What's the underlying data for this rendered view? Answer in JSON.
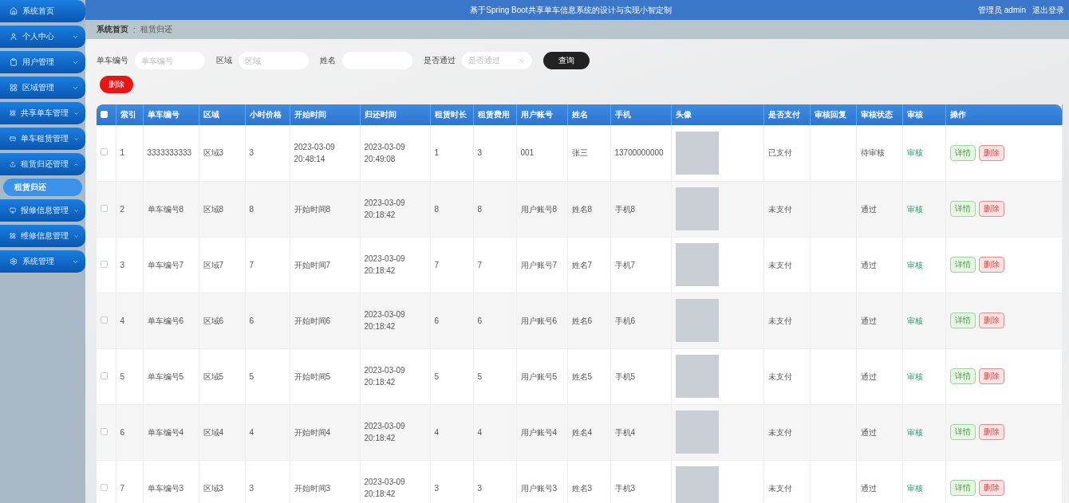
{
  "header": {
    "title": "基于Spring Boot共享单车信息系统的设计与实现小智定制",
    "user": "管理员 admin",
    "logout": "退出登录"
  },
  "sidebar": {
    "items": [
      {
        "label": "系统首页"
      },
      {
        "label": "个人中心",
        "expanded": false
      },
      {
        "label": "用户管理",
        "expanded": false
      },
      {
        "label": "区域管理",
        "expanded": false
      },
      {
        "label": "共享单车管理",
        "expanded": false
      },
      {
        "label": "单车租赁管理",
        "expanded": false
      },
      {
        "label": "租赁归还管理",
        "expanded": true,
        "children": [
          {
            "label": "租赁归还",
            "selected": true
          }
        ]
      },
      {
        "label": "报修信息管理",
        "expanded": false
      },
      {
        "label": "维修信息管理",
        "expanded": false
      },
      {
        "label": "系统管理",
        "expanded": false
      }
    ]
  },
  "breadcrumb": {
    "items": [
      "系统首页",
      "租赁归还"
    ],
    "separator": ":"
  },
  "search": {
    "fields": [
      {
        "label": "单车编号",
        "kind": "input",
        "placeholder": "单车编号"
      },
      {
        "label": "区域",
        "kind": "input",
        "placeholder": "区域"
      },
      {
        "label": "姓名",
        "kind": "input"
      },
      {
        "label": "是否通过",
        "kind": "select",
        "placeholder": "是否通过"
      }
    ],
    "button": "查询"
  },
  "delete_button": "删除",
  "table": {
    "select_all_checked": false,
    "columns": [
      "索引",
      "单车编号",
      "区域",
      "小时价格",
      "开始时间",
      "归还时间",
      "租赁时长",
      "租赁费用",
      "用户账号",
      "姓名",
      "手机",
      "头像",
      "是否支付",
      "审核回复",
      "审核状态",
      "审核",
      "操作"
    ],
    "rows": [
      {
        "cells": [
          "1",
          "3333333333",
          "区域3",
          "3",
          "2023-03-09 20:48:14",
          "2023-03-09 20:49:08",
          "1",
          "3",
          "001",
          "张三",
          "13700000000"
        ],
        "paid": "已支付",
        "status": "待审核",
        "review": "审核",
        "checked": false,
        "actions": [
          "详情",
          "删除"
        ]
      },
      {
        "cells": [
          "2",
          "单车编号8",
          "区域8",
          "8",
          "开始时间8",
          "2023-03-09 20:18:42",
          "8",
          "8",
          "用户账号8",
          "姓名8",
          "手机8"
        ],
        "paid": "未支付",
        "status": "通过",
        "review": "审核",
        "checked": false,
        "actions": [
          "详情",
          "删除"
        ]
      },
      {
        "cells": [
          "3",
          "单车编号7",
          "区域7",
          "7",
          "开始时间7",
          "2023-03-09 20:18:42",
          "7",
          "7",
          "用户账号7",
          "姓名7",
          "手机7"
        ],
        "paid": "未支付",
        "status": "通过",
        "review": "审核",
        "checked": false,
        "actions": [
          "详情",
          "删除"
        ]
      },
      {
        "cells": [
          "4",
          "单车编号6",
          "区域6",
          "6",
          "开始时间6",
          "2023-03-09 20:18:42",
          "6",
          "6",
          "用户账号6",
          "姓名6",
          "手机6"
        ],
        "paid": "未支付",
        "status": "通过",
        "review": "审核",
        "checked": false,
        "actions": [
          "详情",
          "删除"
        ]
      },
      {
        "cells": [
          "5",
          "单车编号5",
          "区域5",
          "5",
          "开始时间5",
          "2023-03-09 20:18:42",
          "5",
          "5",
          "用户账号5",
          "姓名5",
          "手机5"
        ],
        "paid": "未支付",
        "status": "通过",
        "review": "审核",
        "checked": false,
        "actions": [
          "详情",
          "删除"
        ]
      },
      {
        "cells": [
          "6",
          "单车编号4",
          "区域4",
          "4",
          "开始时间4",
          "2023-03-09 20:18:42",
          "4",
          "4",
          "用户账号4",
          "姓名4",
          "手机4"
        ],
        "paid": "未支付",
        "status": "通过",
        "review": "审核",
        "checked": false,
        "actions": [
          "详情",
          "删除"
        ]
      },
      {
        "cells": [
          "7",
          "单车编号3",
          "区域3",
          "3",
          "开始时间3",
          "2023-03-09 20:18:42",
          "3",
          "3",
          "用户账号3",
          "姓名3",
          "手机3"
        ],
        "paid": "未支付",
        "status": "通过",
        "review": "审核",
        "checked": false,
        "actions": [
          "详情",
          "删除"
        ]
      }
    ]
  }
}
